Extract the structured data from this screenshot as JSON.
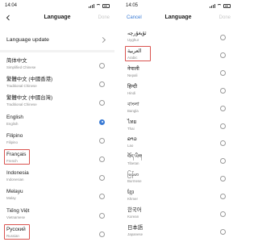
{
  "left": {
    "time": "14:04",
    "title": "Language",
    "done": "Done",
    "update_label": "Language update",
    "languages": [
      {
        "name": "简体中文",
        "sub": "Simplified Chinese",
        "selected": false
      },
      {
        "name": "繁體中文 (中國香港)",
        "sub": "Traditional Chinese",
        "selected": false
      },
      {
        "name": "繁體中文 (中國台灣)",
        "sub": "Traditional Chinese",
        "selected": false
      },
      {
        "name": "English",
        "sub": "English",
        "selected": true
      },
      {
        "name": "Filipino",
        "sub": "Filipino",
        "selected": false
      },
      {
        "name": "Français",
        "sub": "French",
        "selected": false,
        "highlighted": true
      },
      {
        "name": "Indonesia",
        "sub": "Indonesian",
        "selected": false
      },
      {
        "name": "Melayu",
        "sub": "Malay",
        "selected": false
      },
      {
        "name": "Tiếng Việt",
        "sub": "Vietnamese",
        "selected": false
      },
      {
        "name": "Русский",
        "sub": "Russian",
        "selected": false,
        "highlighted": true
      }
    ]
  },
  "right": {
    "time": "14:05",
    "title": "Language",
    "cancel": "Cancel",
    "done": "Done",
    "languages": [
      {
        "name": "ئۇيغۇرچە",
        "sub": "Uyghur",
        "selected": false
      },
      {
        "name": "العربية",
        "sub": "Arabic",
        "selected": false,
        "highlighted": true
      },
      {
        "name": "नेपाली",
        "sub": "Nepali",
        "selected": false
      },
      {
        "name": "हिन्दी",
        "sub": "Hindi",
        "selected": false
      },
      {
        "name": "বাংলা",
        "sub": "Bangla",
        "selected": false
      },
      {
        "name": "ไทย",
        "sub": "Thai",
        "selected": false
      },
      {
        "name": "ລາວ",
        "sub": "Lao",
        "selected": false
      },
      {
        "name": "བོད་ཡིག",
        "sub": "Tibetan",
        "selected": false
      },
      {
        "name": "မြန်မာ",
        "sub": "Burmese",
        "selected": false
      },
      {
        "name": "ខ្មែរ",
        "sub": "Khmer",
        "selected": false
      },
      {
        "name": "한국어",
        "sub": "Korean",
        "selected": false
      },
      {
        "name": "日本語",
        "sub": "Japanese",
        "selected": false
      }
    ]
  },
  "colors": {
    "accent": "#3a7bd5",
    "highlight": "#d9534f",
    "done_disabled": "#c8c8c8"
  }
}
